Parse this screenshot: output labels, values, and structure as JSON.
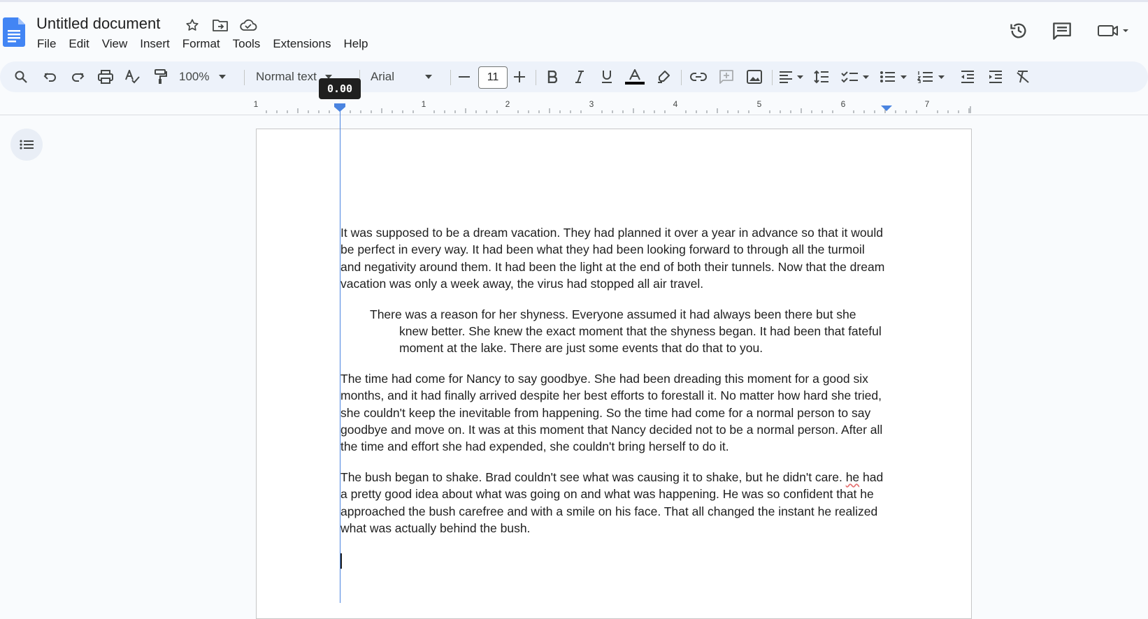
{
  "document": {
    "title": "Untitled document"
  },
  "menu": [
    "File",
    "Edit",
    "View",
    "Insert",
    "Format",
    "Tools",
    "Extensions",
    "Help"
  ],
  "toolbar": {
    "zoom": "100%",
    "style": "Normal text",
    "font": "Arial",
    "font_size": "11"
  },
  "ruler": {
    "labels": [
      "1",
      "1",
      "2",
      "3",
      "4",
      "5",
      "6",
      "7"
    ],
    "tooltip": "0.00"
  },
  "body": {
    "p1": "It was supposed to be a dream vacation. They had planned it over a year in advance so that it would be perfect in every way. It had been what they had been looking forward to through all the turmoil and negativity around them. It had been the light at the end of both their tunnels. Now that the dream vacation was only a week away, the virus had stopped all air travel.",
    "p2": "There was a reason for her shyness. Everyone assumed it had always been there but she knew better. She knew the exact moment that the shyness began. It had been that fateful moment at the lake. There are just some events that do that to you.",
    "p3": "The time had come for Nancy to say goodbye. She had been dreading this moment for a good six months, and it had finally arrived despite her best efforts to forestall it. No matter how hard she tried, she couldn't keep the inevitable from happening. So the time had come for a normal person to say goodbye and move on. It was at this moment that Nancy decided not to be a normal person. After all the time and effort she had expended, she couldn't bring herself to do it.",
    "p4_start": "The bush began to shake. Brad couldn't see what was causing it to shake, but he didn't care. ",
    "p4_flagged": "he",
    "p4_end": " had a pretty good idea about what was going on and what was happening. He was so confident that he approached the bush carefree and with a smile on his face. That all changed the instant he realized what was actually behind the bush."
  },
  "colors": {
    "accent": "#0b57d0",
    "guide": "#4a84e0",
    "toolbar_bg": "#edf2fa",
    "docs_blue": "#4285f4"
  }
}
